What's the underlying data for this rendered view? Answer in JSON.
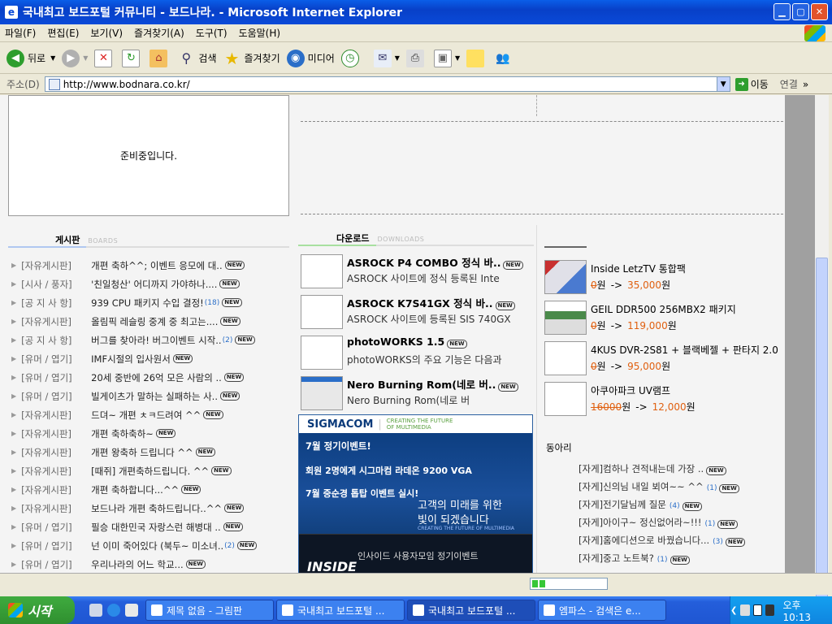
{
  "window": {
    "title": "국내최고 보드포털 커뮤니티 - 보드나라. - Microsoft Internet Explorer"
  },
  "menu": [
    "파일(F)",
    "편집(E)",
    "보기(V)",
    "즐겨찾기(A)",
    "도구(T)",
    "도움말(H)"
  ],
  "toolbar": {
    "back": "뒤로",
    "search": "검색",
    "favorites": "즐겨찾기",
    "media": "미디어"
  },
  "address": {
    "label": "주소(D)",
    "url": "http://www.bodnara.co.kr/",
    "go": "이동",
    "links": "연결"
  },
  "page": {
    "preparing": "준비중입니다.",
    "boards_title": "게시판",
    "boards_en": "BOARDS",
    "downloads_title": "다운로드",
    "downloads_en": "DOWNLOADS",
    "club_title": "동아리",
    "new_badge": "NEW",
    "boards": [
      {
        "cat": "[자유게시판]",
        "title": "개편 축하^^; 이벤트 응모에 대..",
        "count": ""
      },
      {
        "cat": "[시사 / 풍자]",
        "title": "'친일청산' 어디까지 가야하나....",
        "count": ""
      },
      {
        "cat": "[공 지 사 항]",
        "title": "939 CPU 패키지 수입 결정!",
        "count": "(18)"
      },
      {
        "cat": "[자유게시판]",
        "title": "올림픽 레슬링 중계 중 최고는....",
        "count": ""
      },
      {
        "cat": "[공 지 사 항]",
        "title": "버그를 찾아라! 버그이벤트 시작..",
        "count": "(2)"
      },
      {
        "cat": "[유머 / 엽기]",
        "title": "IMF시절의 입사원서",
        "count": ""
      },
      {
        "cat": "[유머 / 엽기]",
        "title": "20세 중반에 26억 모은 사람의 ..",
        "count": ""
      },
      {
        "cat": "[유머 / 엽기]",
        "title": "빌게이츠가 말하는 실패하는 사..",
        "count": ""
      },
      {
        "cat": "[자유게시판]",
        "title": "드뎌~ 개편 ㅊㅋ드려여 ^^",
        "count": ""
      },
      {
        "cat": "[자유게시판]",
        "title": "개편 축하축하~",
        "count": ""
      },
      {
        "cat": "[자유게시판]",
        "title": "개편 왕축하 드립니다 ^^",
        "count": ""
      },
      {
        "cat": "[자유게시판]",
        "title": "[때쥐] 개편축하드립니다. ^^",
        "count": ""
      },
      {
        "cat": "[자유게시판]",
        "title": "개편 축하합니다...^^",
        "count": ""
      },
      {
        "cat": "[자유게시판]",
        "title": "보드나라 개편 축하드립니다..^^",
        "count": ""
      },
      {
        "cat": "[유머 / 엽기]",
        "title": "필승 대한민국 자랑스런 해병대 ..",
        "count": ""
      },
      {
        "cat": "[유머 / 엽기]",
        "title": "넌 이미 죽어있다 (북두~ 미소녀..",
        "count": "(2)"
      },
      {
        "cat": "[유머 / 엽기]",
        "title": "우리나라의 어느 학교...",
        "count": ""
      }
    ],
    "downloads": [
      {
        "title": "ASROCK P4 COMBO 정식 바..",
        "desc": "ASROCK 사이트에 정식 등록된 Inte"
      },
      {
        "title": "ASROCK K7S41GX 정식 바..",
        "desc": "ASROCK 사이트에 등록된 SIS 740GX"
      },
      {
        "title": "photoWORKS 1.5",
        "desc": "photoWORKS의 주요 기능은 다음과"
      },
      {
        "title": "Nero Burning Rom(네로 버..",
        "desc": "Nero Burning Rom(네로 버"
      }
    ],
    "products": [
      {
        "name": "Inside LetzTV 통합팩",
        "old": "0",
        "new": "35,000"
      },
      {
        "name": "GEIL DDR500 256MBX2 패키지",
        "old": "0",
        "new": "119,000"
      },
      {
        "name": "4KUS DVR-2S81 + 블랙베젤 + 판타지 2.0",
        "old": "0",
        "new": "95,000"
      },
      {
        "name": "아쿠아파크 UV램프",
        "old": "16000",
        "new": "12,000"
      }
    ],
    "won": "원",
    "arrow": "->",
    "banner": {
      "brand": "SIGMACOM",
      "brand_sub1": "CREATING THE FUTURE",
      "brand_sub2": "OF MULTIMEDIA",
      "line1": "7월 정기이벤트!",
      "line2": "회원 2명에게 시그마컴 라데온 9200 VGA",
      "line3": "7월 중순경 톱탑 이벤트 실시!",
      "line4": "고객의 미래를 위한",
      "line5": "빛이 되겠습니다",
      "small": "CREATING THE FUTURE OF MULTIMEDIA",
      "bottom": "인사이드 사용자모임 정기이벤트",
      "bottom_brand": "INSIDE"
    },
    "clubs": [
      {
        "title": "[자게]컴하나 견적내는데 가장 ..",
        "count": ""
      },
      {
        "title": "[자게]신의님 내일 뵈여~~ ^^",
        "count": "(1)"
      },
      {
        "title": "[자게]전기달님께 질문",
        "count": "(4)"
      },
      {
        "title": "[자게]아이구~ 정신없어라~!!!",
        "count": "(1)"
      },
      {
        "title": "[자게]홈에디션으로 바꿨습니다...",
        "count": "(3)"
      },
      {
        "title": "[자게]중고 노트북?",
        "count": "(1)"
      }
    ]
  },
  "status": {
    "progress": 0.2
  },
  "taskbar": {
    "start": "시작",
    "tasks": [
      "제목 없음 - 그림판",
      "국내최고 보드포털 ...",
      "국내최고 보드포털 ...",
      "엠파스 - 검색은 e..."
    ],
    "time": "오후 10:13"
  },
  "colors": {
    "price": "#e06010",
    "count": "#2a6ec8",
    "titlebar": "#0a4ad8"
  }
}
